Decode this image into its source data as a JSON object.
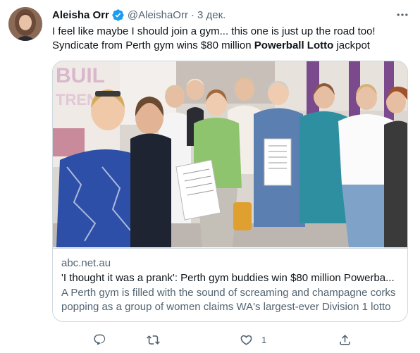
{
  "tweet": {
    "author_name": "Aleisha Orr",
    "author_handle": "@AleishaOrr",
    "separator": "·",
    "timestamp": "3 дек.",
    "verified": true,
    "text_line1": "I feel like maybe I should join a gym... this one is just up the road too!",
    "text_line2_prefix": "Syndicate from Perth gym wins $80 million ",
    "text_line2_bold": "Powerball Lotto",
    "text_line2_suffix": " jackpot"
  },
  "card": {
    "domain": "abc.net.au",
    "title": "'I thought it was a prank': Perth gym buddies win $80 million Powerba...",
    "description": "A Perth gym is filled with the sound of screaming and champagne corks popping as a group of women claims WA's largest-ever Division 1 lotto ...",
    "image_text": "BUIL TRENG"
  },
  "actions": {
    "reply_count": "",
    "retweet_count": "",
    "like_count": "1",
    "share_count": ""
  },
  "colors": {
    "text_primary": "#0f1419",
    "text_secondary": "#536471",
    "verified_blue": "#1d9bf0",
    "border": "#cfd9de",
    "gym_purple": "#7b4a8c"
  },
  "icons": [
    "verified-badge-icon",
    "more-options-icon",
    "reply-icon",
    "retweet-icon",
    "like-icon",
    "share-icon"
  ]
}
